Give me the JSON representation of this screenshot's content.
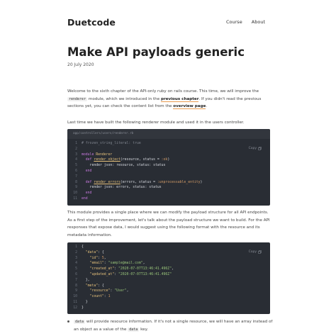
{
  "site": {
    "brand": "Duetcode",
    "nav": [
      "Course",
      "About"
    ]
  },
  "post": {
    "title": "Make API payloads generic",
    "date": "20 July 2020"
  },
  "intro": {
    "text_1": "Welcome to the sixth chapter of the API-only ruby on rails course. This time, we will improve the ",
    "code_1": "renderer",
    "text_2": " module, which we introduced in the ",
    "link_1": "previous chapter",
    "text_3": ". If you didn't read the previous sections yet, you can check the content list from the ",
    "link_2": "overview page",
    "text_4": "."
  },
  "para_last_time": "Last time we have built the following renderer module and used it in the users controller.",
  "code_block_1": {
    "filename": "app/controllers/users/renderer.rb",
    "copy_label": "Copy",
    "lines": [
      {
        "n": "1",
        "parts": [
          [
            "c-com",
            "# frozen_string_literal: true"
          ]
        ]
      },
      {
        "n": "2",
        "parts": [
          [
            "",
            ""
          ]
        ]
      },
      {
        "n": "3",
        "parts": [
          [
            "c-kw2",
            "module "
          ],
          [
            "c-kw",
            "Renderer"
          ]
        ]
      },
      {
        "n": "4",
        "parts": [
          [
            "c-ident",
            "  "
          ],
          [
            "c-kw2",
            "def "
          ],
          [
            "c-fn",
            "render_object"
          ],
          [
            "c-ident",
            "(resource, status = "
          ],
          [
            "c-sym",
            ":ok"
          ],
          [
            "c-ident",
            ")"
          ]
        ]
      },
      {
        "n": "5",
        "parts": [
          [
            "c-ident",
            "    render json: resource, status: status"
          ]
        ]
      },
      {
        "n": "6",
        "parts": [
          [
            "c-ident",
            "  "
          ],
          [
            "c-kw2",
            "end"
          ]
        ]
      },
      {
        "n": "7",
        "parts": [
          [
            "",
            ""
          ]
        ]
      },
      {
        "n": "8",
        "parts": [
          [
            "c-ident",
            "  "
          ],
          [
            "c-kw2",
            "def "
          ],
          [
            "c-fn",
            "render_errors"
          ],
          [
            "c-ident",
            "(errors, status = "
          ],
          [
            "c-sym",
            ":unprocessable_entity"
          ],
          [
            "c-ident",
            ")"
          ]
        ]
      },
      {
        "n": "9",
        "parts": [
          [
            "c-ident",
            "    render json: errors, status: status"
          ]
        ]
      },
      {
        "n": "10",
        "parts": [
          [
            "c-ident",
            "  "
          ],
          [
            "c-kw2",
            "end"
          ]
        ]
      },
      {
        "n": "11",
        "parts": [
          [
            "c-kw2",
            "end"
          ]
        ]
      }
    ]
  },
  "para_module": "This module provides a single place where we can modify the payload structure for all API endpoints. As a first step of the improvement, let's talk about the payload structure we want to build. For the API responses that expose data, I would suggest using the following format with the resource and its metadata information.",
  "code_block_2": {
    "copy_label": "Copy",
    "lines": [
      {
        "n": "1",
        "parts": [
          [
            "c-ident",
            "{"
          ]
        ]
      },
      {
        "n": "2",
        "parts": [
          [
            "c-ident",
            "  "
          ],
          [
            "c-key",
            "\"data\""
          ],
          [
            "c-ident",
            ": {"
          ]
        ]
      },
      {
        "n": "3",
        "parts": [
          [
            "c-ident",
            "    "
          ],
          [
            "c-key",
            "\"id\""
          ],
          [
            "c-ident",
            ": "
          ],
          [
            "c-num",
            "5"
          ],
          [
            "c-ident",
            ","
          ]
        ]
      },
      {
        "n": "4",
        "parts": [
          [
            "c-ident",
            "    "
          ],
          [
            "c-key",
            "\"email\""
          ],
          [
            "c-ident",
            ": "
          ],
          [
            "c-str",
            "\"sample@mail.com\""
          ],
          [
            "c-ident",
            ","
          ]
        ]
      },
      {
        "n": "5",
        "parts": [
          [
            "c-ident",
            "    "
          ],
          [
            "c-key",
            "\"created_at\""
          ],
          [
            "c-ident",
            ": "
          ],
          [
            "c-str",
            "\"2020-07-07T13:46:41.496Z\""
          ],
          [
            "c-ident",
            ","
          ]
        ]
      },
      {
        "n": "6",
        "parts": [
          [
            "c-ident",
            "    "
          ],
          [
            "c-key",
            "\"updated_at\""
          ],
          [
            "c-ident",
            ": "
          ],
          [
            "c-str",
            "\"2020-07-07T13:46:41.496Z\""
          ]
        ]
      },
      {
        "n": "7",
        "parts": [
          [
            "c-ident",
            "  },"
          ]
        ]
      },
      {
        "n": "8",
        "parts": [
          [
            "c-ident",
            "  "
          ],
          [
            "c-key",
            "\"meta\""
          ],
          [
            "c-ident",
            ": {"
          ]
        ]
      },
      {
        "n": "9",
        "parts": [
          [
            "c-ident",
            "    "
          ],
          [
            "c-key",
            "\"resource\""
          ],
          [
            "c-ident",
            ": "
          ],
          [
            "c-str",
            "\"User\""
          ],
          [
            "c-ident",
            ","
          ]
        ]
      },
      {
        "n": "10",
        "parts": [
          [
            "c-ident",
            "    "
          ],
          [
            "c-key",
            "\"count\""
          ],
          [
            "c-ident",
            ": "
          ],
          [
            "c-num",
            "1"
          ]
        ]
      },
      {
        "n": "11",
        "parts": [
          [
            "c-ident",
            "  }"
          ]
        ]
      },
      {
        "n": "12",
        "parts": [
          [
            "c-ident",
            "}"
          ]
        ]
      }
    ]
  },
  "bullet_1": {
    "code_1": "data",
    "text_1": " will provide resource information. If it's not a single resource, we will have an array instead of an object as a value of the ",
    "code_2": "data",
    "text_2": " key."
  }
}
